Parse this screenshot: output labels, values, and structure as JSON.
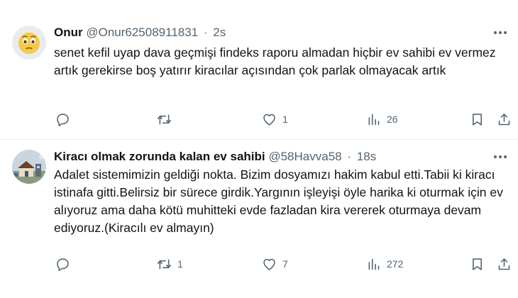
{
  "tweets": [
    {
      "author": "Onur",
      "handle": "@Onur62508911831",
      "separator": "·",
      "time": "2s",
      "avatar": "emoji-face-avatar",
      "text": "senet kefil uyap dava geçmişi findeks raporu almadan hiçbir ev sahibi ev vermez  artık gerekirse boş yatırır kiracılar açısından çok parlak olmayacak artık",
      "replies": "",
      "retweets": "",
      "likes": "1",
      "views": "26"
    },
    {
      "author": "Kiracı olmak zorunda kalan ev sahibi",
      "handle": "@58Havva58",
      "separator": "·",
      "time": "18s",
      "avatar": "house-photo-avatar",
      "text": "Adalet sistemimizin geldiği nokta. Bizim dosyamızı hakim kabul etti.Tabii ki kiracı istinafa gitti.Belirsiz bir sürece girdik.Yargının işleyişi öyle harika ki oturmak için ev alıyoruz ama daha kötü muhitteki evde fazladan kira vererek oturmaya devam ediyoruz.(Kiracılı ev almayın)",
      "replies": "",
      "retweets": "1",
      "likes": "7",
      "views": "272"
    }
  ],
  "colors": {
    "text": "#0f1419",
    "muted": "#536471",
    "divider": "#eff3f4"
  }
}
